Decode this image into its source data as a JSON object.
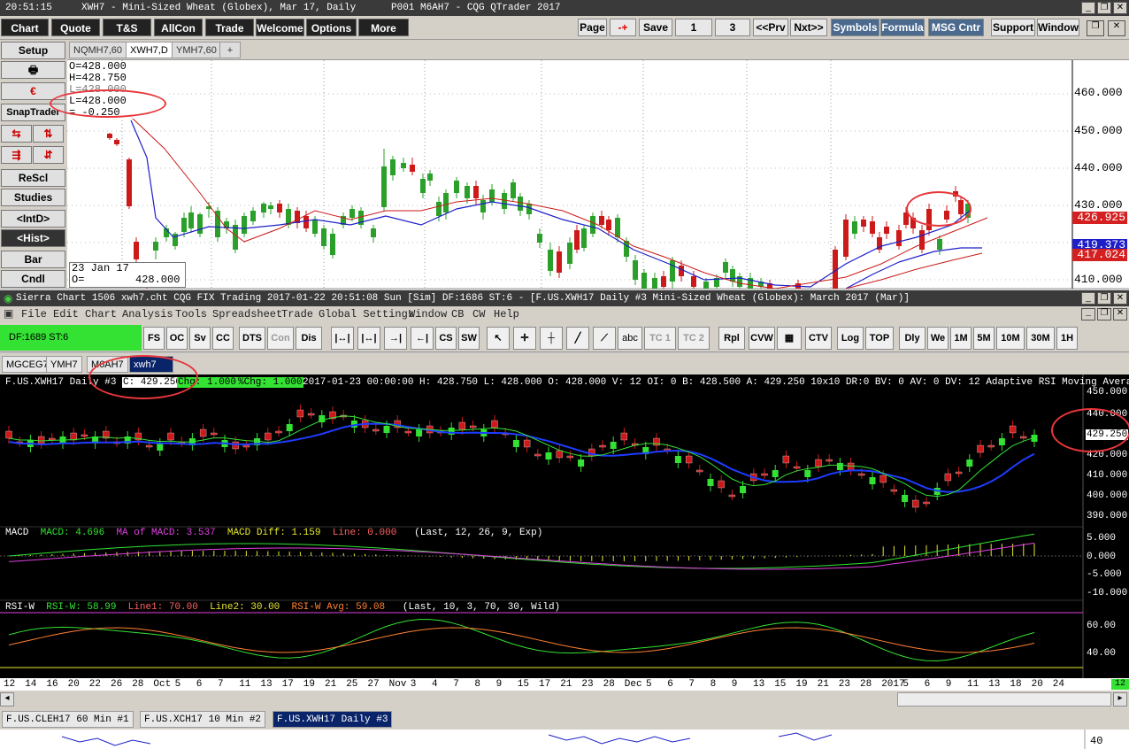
{
  "cqg": {
    "title": {
      "time": "20:51:15",
      "text": "XWH7 - Mini-Sized Wheat (Globex), Mar 17, Daily",
      "page": "P001 M6AH7 - CQG QTrader 2017"
    },
    "menu": [
      "Chart",
      "Quote",
      "T&S",
      "AllCon",
      "Trade",
      "Welcome",
      "Options",
      "More"
    ],
    "right_buttons": [
      "Page",
      "-+",
      "Save",
      "1",
      "3",
      "<<Prv",
      "Nxt>>",
      "Symbols",
      "Formula",
      "MSG Cntr",
      "Support",
      "Window"
    ],
    "side": [
      "Setup",
      "",
      "",
      "SnapTrader",
      "",
      "",
      "ReScl",
      "Studies",
      "<IntD>",
      "<Hist>",
      "Bar",
      "Cndl"
    ],
    "tabs": [
      "NQMH7,60",
      "XWH7,D",
      "YMH7,60",
      "+"
    ],
    "ohlc": [
      "O=428.000",
      "H=428.750",
      "L=428.000",
      "L=428.000",
      "= -0.250"
    ],
    "date_box": {
      "date": "23 Jan 17",
      "label": "O=",
      "value": "428.000"
    },
    "price_axis": [
      "460.000",
      "450.000",
      "440.000",
      "430.000",
      "410.000"
    ],
    "price_tags": [
      {
        "value": "426.925",
        "color": "#d42020"
      },
      {
        "value": "419.373",
        "color": "#1e1ec8"
      },
      {
        "value": "417.024",
        "color": "#d42020"
      }
    ]
  },
  "sierra": {
    "title": "Sierra Chart 1506 xwh7.cht   CQG FIX Trading 2017-01-22  20:51:08 Sun [Sim]  DF:1686  ST:6 - [F.US.XWH17  Daily  #3  Mini-Sized Wheat (Globex): March 2017 (Mar)]",
    "menu": [
      "File",
      "Edit",
      "Chart",
      "Analysis",
      "Tools",
      "Spreadsheet",
      "Trade",
      "Global Settings",
      "Window",
      "CB",
      "CW",
      "Help"
    ],
    "status": "DF:1689  ST:6",
    "toolbar": [
      "FS",
      "OC",
      "Sv",
      "CC",
      "DTS",
      "Con",
      "Dis",
      "CS",
      "SW",
      "abc",
      "TC 1",
      "TC 2",
      "Rpl",
      "CVW",
      "CTV",
      "Log",
      "TOP",
      "Dly",
      "We",
      "1M",
      "5M",
      "10M",
      "30M",
      "1H"
    ],
    "chart_tabs": [
      "MGCEG7",
      "YMH7",
      "M6AH7",
      "xwh7"
    ],
    "header_line": {
      "prefix": "F.US.XWH17  Daily  #3",
      "c_label": "C: 429.250",
      "chg": "Chg: 1.000",
      "pchg": "%Chg: 1.000",
      "rest": "2017-01-23 00:00:00 H: 428.750  L: 428.000  O: 428.000  V: 12  OI: 0  B: 428.500  A: 429.250  10x10  DR:0  BV: 0  AV: 0  DV: 12  Adaptive RSI Moving Average  W"
    },
    "price_axis": [
      "450.000",
      "440.000",
      "430.000",
      "420.000",
      "410.000",
      "400.000",
      "390.000"
    ],
    "last_price": "429.250",
    "macd": {
      "title": "MACD",
      "macd": "MACD: 4.696",
      "ma": "MA of MACD: 3.537",
      "diff": "MACD Diff: 1.159",
      "line": "Line: 0.000",
      "params": "(Last, 12, 26, 9, Exp)",
      "axis": [
        "5.000",
        "0.000",
        "-5.000",
        "-10.000"
      ]
    },
    "rsi": {
      "title": "RSI-W",
      "rsi": "RSI-W: 58.99",
      "l1": "Line1: 70.00",
      "l2": "Line2: 30.00",
      "avg": "RSI-W Avg: 59.08",
      "params": "(Last, 10, 3, 70, 30, Wild)",
      "axis": [
        "60.00",
        "40.00"
      ]
    },
    "xaxis": [
      "12",
      "14",
      "16",
      "20",
      "22",
      "26",
      "28",
      "Oct",
      "5",
      "6",
      "7",
      "11",
      "13",
      "17",
      "19",
      "21",
      "25",
      "27",
      "Nov",
      "3",
      "4",
      "7",
      "8",
      "9",
      "15",
      "17",
      "21",
      "23",
      "28",
      "Dec",
      "5",
      "6",
      "7",
      "8",
      "9",
      "13",
      "15",
      "19",
      "21",
      "23",
      "28",
      "2017",
      "5",
      "6",
      "9",
      "11",
      "13",
      "18",
      "20",
      "24"
    ],
    "corner_badge": "12",
    "bottom_tabs": [
      "F.US.CLEH17  60 Min  #1",
      "F.US.XCH17  10 Min  #2",
      "F.US.XWH17  Daily  #3"
    ],
    "next_axis": "40"
  },
  "chart_data": {
    "type": "candlestick",
    "symbol": "F.US.XWH17",
    "ylim": [
      390,
      450
    ],
    "last": 429.25
  }
}
